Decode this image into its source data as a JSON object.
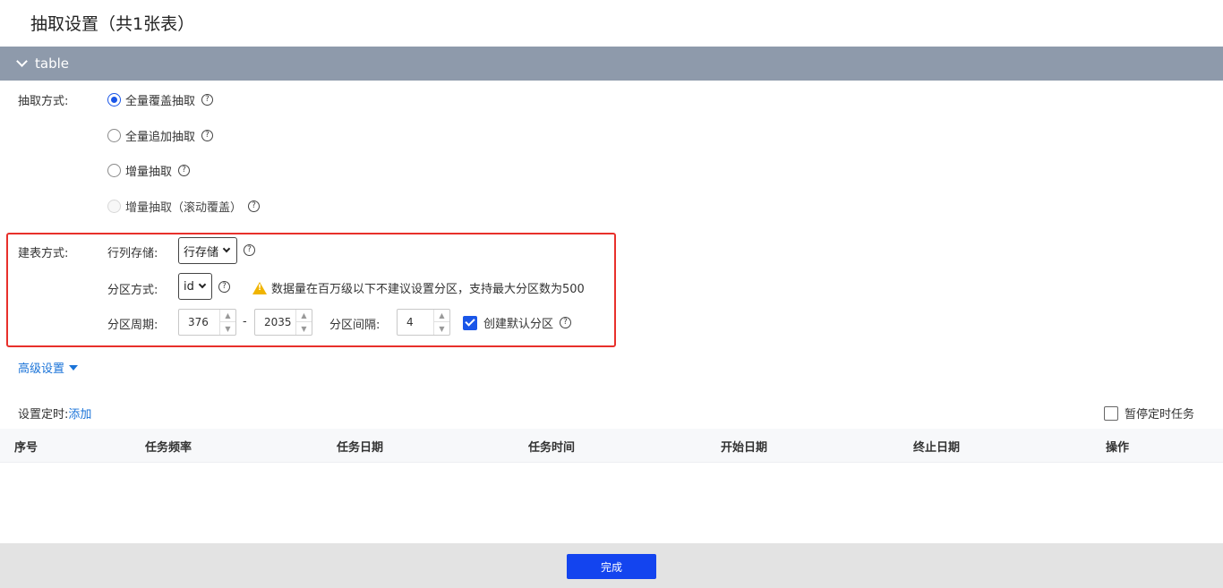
{
  "page": {
    "title": "抽取设置（共1张表）"
  },
  "section": {
    "label": "table"
  },
  "extract": {
    "label": "抽取方式:",
    "options": [
      {
        "label": "全量覆盖抽取",
        "selected": true
      },
      {
        "label": "全量追加抽取",
        "selected": false
      },
      {
        "label": "增量抽取",
        "selected": false
      },
      {
        "label": "增量抽取（滚动覆盖）",
        "selected": false,
        "disabled": true
      }
    ]
  },
  "build": {
    "label": "建表方式:",
    "storage_label": "行列存储:",
    "storage_value": "行存储",
    "partition_label": "分区方式:",
    "partition_value": "id",
    "warning": "数据量在百万级以下不建议设置分区，支持最大分区数为500",
    "period_label": "分区周期:",
    "period_start": "376",
    "period_sep": "-",
    "period_end": "2035",
    "interval_label": "分区间隔:",
    "interval_value": "4",
    "default_partition_label": "创建默认分区",
    "default_partition_checked": true
  },
  "advanced": {
    "label": "高级设置"
  },
  "schedule": {
    "label": "设置定时:",
    "add_label": "添加",
    "pause_label": "暂停定时任务",
    "pause_checked": false
  },
  "table": {
    "columns": [
      "序号",
      "任务频率",
      "任务日期",
      "任务时间",
      "开始日期",
      "终止日期",
      "操作"
    ]
  },
  "footer": {
    "done_label": "完成"
  },
  "colors": {
    "accent": "#1a56e8",
    "highlight_box": "#e8302b",
    "section_bar": "#8e9aab",
    "primary_button": "#1344ef"
  }
}
